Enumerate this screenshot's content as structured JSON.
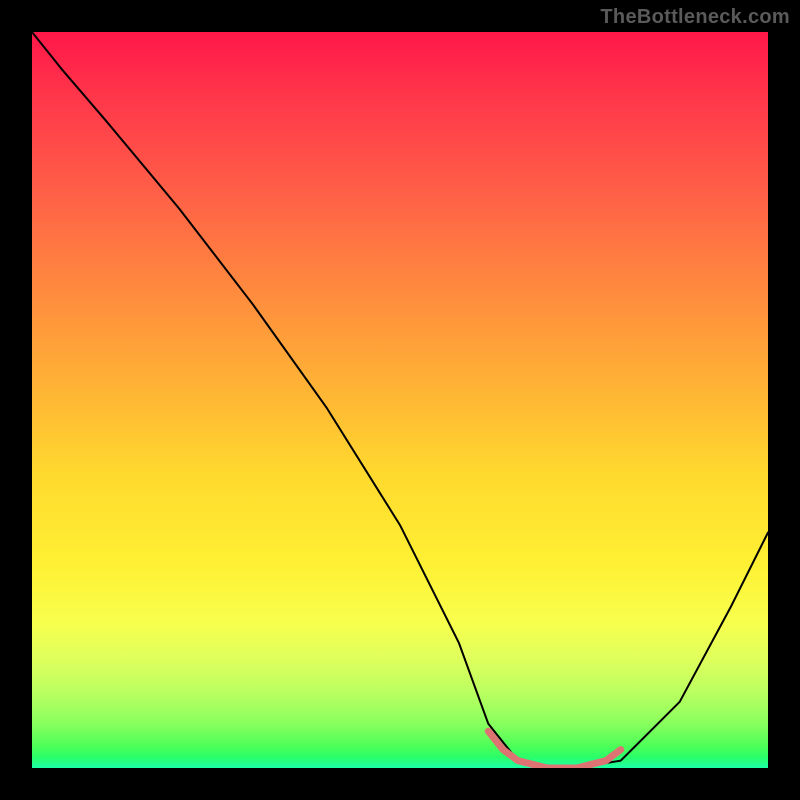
{
  "watermark": "TheBottleneck.com",
  "chart_data": {
    "type": "line",
    "title": "",
    "xlabel": "",
    "ylabel": "",
    "xlim": [
      0,
      100
    ],
    "ylim": [
      0,
      100
    ],
    "series": [
      {
        "name": "black-curve",
        "color": "#000000",
        "width": 2,
        "x": [
          0,
          4,
          10,
          20,
          30,
          40,
          50,
          58,
          62,
          66,
          70,
          74,
          80,
          88,
          95,
          100
        ],
        "y": [
          100,
          95,
          88,
          76,
          63,
          49,
          33,
          17,
          6,
          1,
          0,
          0,
          1,
          9,
          22,
          32
        ]
      },
      {
        "name": "highlight-min",
        "color": "#e07070",
        "width": 6,
        "x": [
          62,
          64,
          66,
          68,
          70,
          72,
          74,
          76,
          78,
          80
        ],
        "y": [
          5,
          2.5,
          1,
          0.5,
          0,
          0,
          0,
          0.5,
          1,
          2.5
        ]
      }
    ],
    "grid": false,
    "legend": false
  }
}
